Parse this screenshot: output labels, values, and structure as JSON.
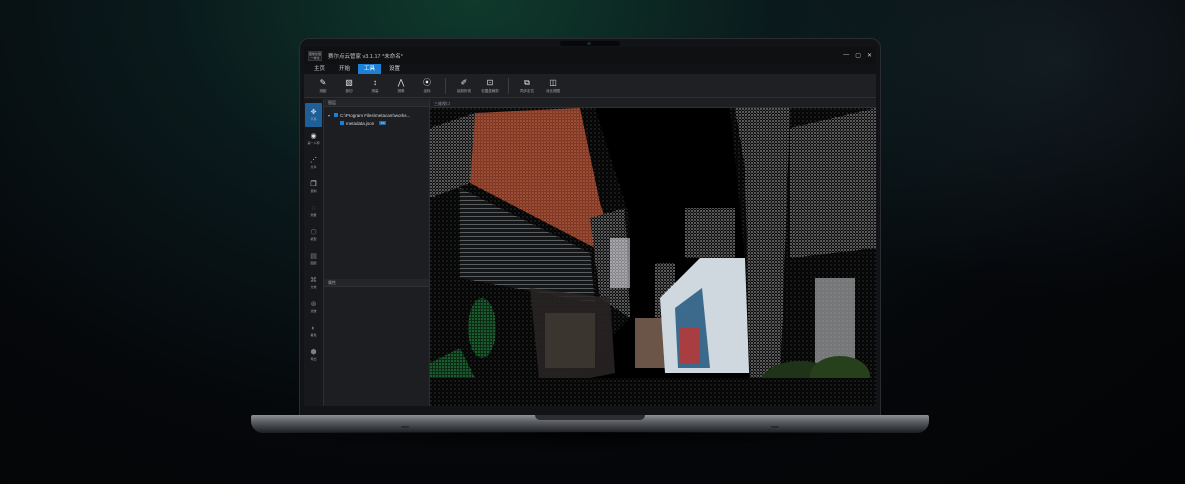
{
  "app": {
    "logo_text": "图像处理\n一体化",
    "title": "赛尔点云管家 v3.1.17 *未命名*",
    "window_controls": [
      "—",
      "▢",
      "✕"
    ]
  },
  "menu": {
    "items": [
      "主页",
      "开始",
      "工具",
      "设置"
    ],
    "active_index": 2
  },
  "toolbar": {
    "tools": [
      {
        "label": "测距",
        "icon": "ruler-icon",
        "glyph": "✎"
      },
      {
        "label": "剖切",
        "icon": "section-icon",
        "glyph": "▧"
      },
      {
        "label": "测高",
        "icon": "height-icon",
        "glyph": "↕"
      },
      {
        "label": "测角",
        "icon": "angle-icon",
        "glyph": "⋀"
      },
      {
        "label": "坐标",
        "icon": "location-pin-icon",
        "glyph": "⦿"
      },
      {
        "label": "绘制折线",
        "icon": "pen-icon",
        "glyph": "✐"
      },
      {
        "label": "包围盒裁剪",
        "icon": "crop-box-icon",
        "glyph": "⊡"
      },
      {
        "label": "同步定位",
        "icon": "sync-locate-icon",
        "glyph": "⧉"
      },
      {
        "label": "对比视图",
        "icon": "split-view-icon",
        "glyph": "◫"
      }
    ]
  },
  "sidebar": {
    "items": [
      {
        "label": "平移",
        "icon": "move-icon",
        "glyph": "✥"
      },
      {
        "label": "第一人称",
        "icon": "eye-icon",
        "glyph": "◉"
      },
      {
        "label": "分享",
        "icon": "share-icon",
        "glyph": "⋰"
      },
      {
        "label": "复制",
        "icon": "copy-icon",
        "glyph": "❐"
      },
      {
        "label": "测量",
        "icon": "measure-icon",
        "glyph": "◌"
      },
      {
        "label": "模型",
        "icon": "cube-icon",
        "glyph": "⬡"
      },
      {
        "label": "图层",
        "icon": "layers-icon",
        "glyph": "▤"
      },
      {
        "label": "分类",
        "icon": "classify-icon",
        "glyph": "⌘"
      },
      {
        "label": "滤波",
        "icon": "filter-icon",
        "glyph": "⊛"
      },
      {
        "label": "着色",
        "icon": "color-icon",
        "glyph": "◐"
      },
      {
        "label": "导出",
        "icon": "export-icon",
        "glyph": "⬢"
      }
    ]
  },
  "scene_panel": {
    "title": "图层",
    "tree": {
      "root": "C:\\Program Files\\metacam\\works...",
      "child": "metadata.json",
      "child_tag": "PC"
    }
  },
  "props_panel": {
    "title": "属性"
  },
  "viewport": {
    "title": "三维视口"
  }
}
